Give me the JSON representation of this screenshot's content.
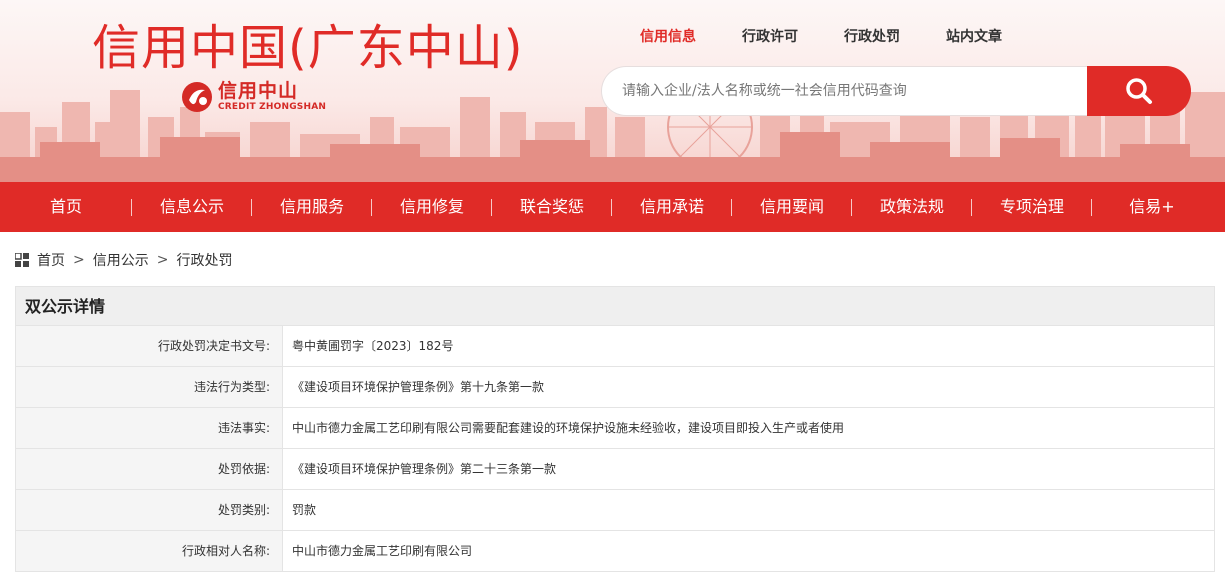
{
  "header": {
    "site_title": "信用中国(广东中山)",
    "logo_cn": "信用中山",
    "logo_en": "CREDIT ZHONGSHAN",
    "top_links": [
      "信用信息",
      "行政许可",
      "行政处罚",
      "站内文章"
    ],
    "search_placeholder": "请输入企业/法人名称或统一社会信用代码查询",
    "accent": "#e02b27"
  },
  "nav": [
    "首页",
    "信息公示",
    "信用服务",
    "信用修复",
    "联合奖惩",
    "信用承诺",
    "信用要闻",
    "政策法规",
    "专项治理",
    "信易+"
  ],
  "breadcrumb": [
    "首页",
    "信用公示",
    "行政处罚"
  ],
  "detail": {
    "title": "双公示详情",
    "rows": [
      {
        "label": "行政处罚决定书文号:",
        "value": "粤中黄圃罚字〔2023〕182号"
      },
      {
        "label": "违法行为类型:",
        "value": "《建设项目环境保护管理条例》第十九条第一款"
      },
      {
        "label": "违法事实:",
        "value": "中山市德力金属工艺印刷有限公司需要配套建设的环境保护设施未经验收，建设项目即投入生产或者使用"
      },
      {
        "label": "处罚依据:",
        "value": "《建设项目环境保护管理条例》第二十三条第一款"
      },
      {
        "label": "处罚类别:",
        "value": "罚款"
      },
      {
        "label": "行政相对人名称:",
        "value": "中山市德力金属工艺印刷有限公司"
      }
    ]
  }
}
